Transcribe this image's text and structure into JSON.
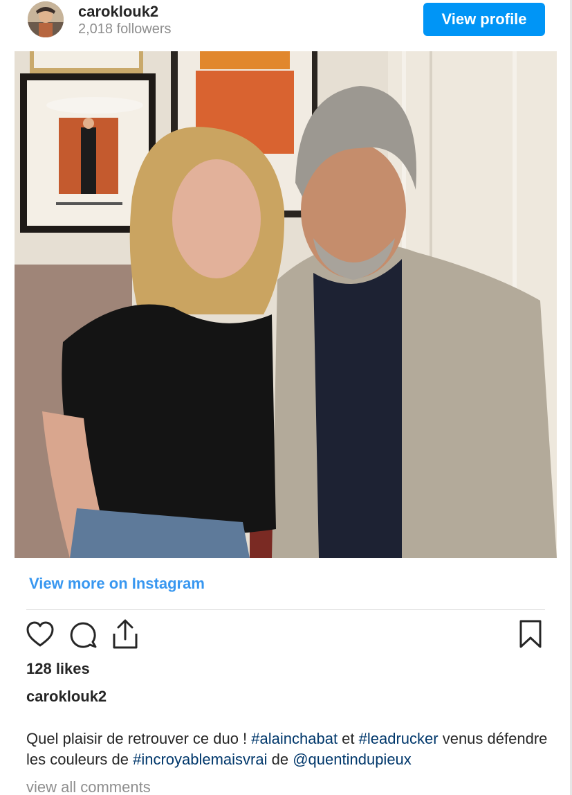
{
  "header": {
    "username": "caroklouk2",
    "followers": "2,018 followers",
    "view_profile_label": "View profile"
  },
  "footer": {
    "view_more_label": "View more on Instagram",
    "likes": "128 likes",
    "caption_username": "caroklouk2",
    "caption": {
      "t1": "Quel plaisir de retrouver ce duo ! ",
      "h1": "#alainchabat",
      "t2": " et ",
      "h2": "#leadrucker",
      "t3": " venus défendre les couleurs de ",
      "h3": "#incroyablemaisvrai",
      "t4": " de ",
      "h4": "@quentindupieux"
    },
    "view_comments_label": "view all comments"
  },
  "icons": {
    "like": "heart-icon",
    "comment": "comment-bubble-icon",
    "share": "share-icon",
    "save": "bookmark-icon"
  },
  "colors": {
    "accent": "#0095f6",
    "link": "#3897f0",
    "hashtag": "#00376b",
    "muted": "#8e8e8e"
  }
}
